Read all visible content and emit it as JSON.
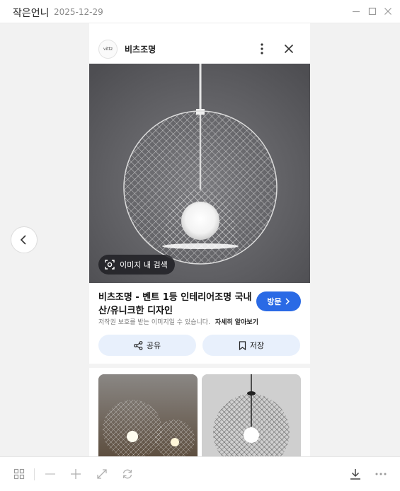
{
  "window": {
    "title": "작은언니",
    "date": "2025-12-29"
  },
  "source": {
    "logo_text": "vittz",
    "name": "비츠조명"
  },
  "image_search": {
    "label": "이미지 내 검색"
  },
  "result": {
    "title": "비츠조명 - 벤트 1등 인테리어조명 국내산/유니크한 디자인",
    "visit_label": "방문",
    "notice": "저작권 보호를 받는 이미지일 수 있습니다.",
    "learn_more": "자세히 알아보기"
  },
  "actions": {
    "share_label": "공유",
    "save_label": "저장"
  },
  "icons": {
    "titlebar": [
      "minimize-icon",
      "maximize-icon",
      "close-icon"
    ],
    "header": [
      "more-vertical-icon",
      "close-icon"
    ],
    "toolbar": [
      "grid-icon",
      "zoom-out-icon",
      "zoom-in-icon",
      "expand-icon",
      "rotate-icon",
      "download-icon",
      "more-horizontal-icon"
    ]
  },
  "colors": {
    "accent": "#2a6ae5",
    "action_bg": "#e8f0fc",
    "viewer_bg": "#f2f2f2"
  }
}
